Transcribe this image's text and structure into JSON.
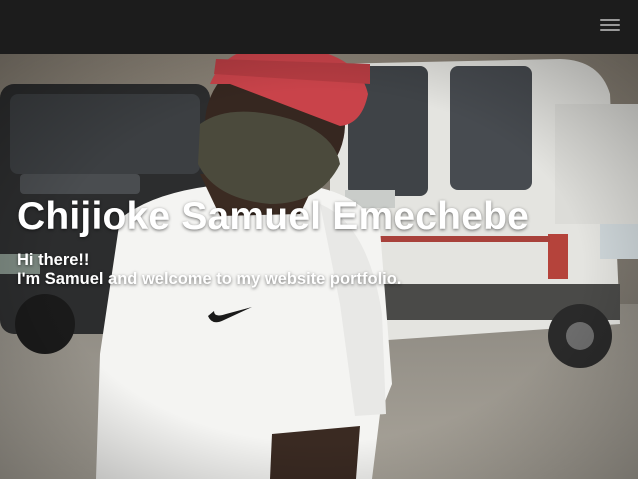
{
  "navbar": {
    "menu_icon": "hamburger-menu-icon",
    "background": "#1c1c1c"
  },
  "hero": {
    "title": "Chijioke Samuel Emechebe",
    "greeting": "Hi there!!",
    "welcome": "I'm Samuel and welcome to my website portfolio.",
    "text_color": "#ffffff"
  },
  "colors": {
    "cap": "#c9434a",
    "shirt": "#f4f4f2",
    "mask": "#4b4a3c",
    "van": "#e6e6e2"
  }
}
